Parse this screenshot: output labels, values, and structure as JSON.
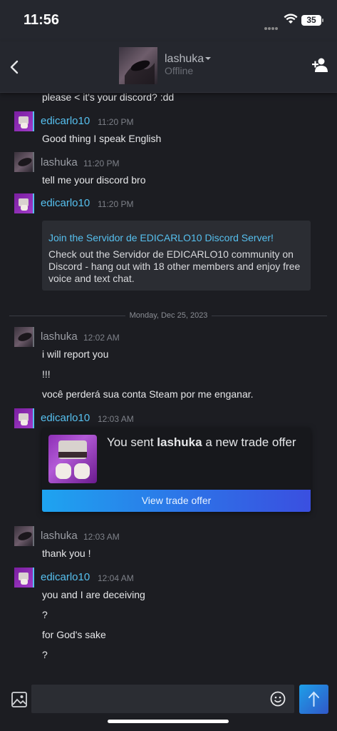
{
  "status_bar": {
    "time": "11:56",
    "battery": "35"
  },
  "header": {
    "contact_name": "lashuka",
    "contact_status": "Offline"
  },
  "messages": [
    {
      "text": "please < it's your discord? :dd"
    },
    {
      "sender": "edicarlo10",
      "time": "11:20 PM",
      "text": "Good thing I speak English"
    },
    {
      "sender": "lashuka",
      "time": "11:20 PM",
      "text": "tell me your discord bro"
    },
    {
      "sender": "edicarlo10",
      "time": "11:20 PM"
    }
  ],
  "embed": {
    "title": "Join the Servidor de EDICARLO10 Discord Server!",
    "description": "Check out the Servidor de EDICARLO10 community on Discord - hang out with 18 other members and enjoy free voice and text chat."
  },
  "date_divider": "Monday, Dec 25, 2023",
  "group2": {
    "sender": "lashuka",
    "time": "12:02 AM",
    "lines": [
      "i will report you",
      "!!!",
      "você perderá sua conta Steam por me enganar."
    ]
  },
  "group3": {
    "sender": "edicarlo10",
    "time": "12:03 AM"
  },
  "trade": {
    "prefix": "You sent ",
    "recipient": "lashuka",
    "suffix": " a new trade offer",
    "button": "View trade offer"
  },
  "group4": {
    "sender": "lashuka",
    "time": "12:03 AM",
    "text": "thank you !"
  },
  "group5": {
    "sender": "edicarlo10",
    "time": "12:04 AM",
    "lines": [
      "you and I are deceiving",
      "?",
      "for God's sake",
      "?"
    ]
  },
  "colors": {
    "accent": "#56c0ef",
    "background": "#1c1d22",
    "header": "#25272e"
  },
  "icons": [
    "back-chevron-icon",
    "add-friend-icon",
    "image-icon",
    "emoji-icon",
    "send-arrow-icon"
  ]
}
